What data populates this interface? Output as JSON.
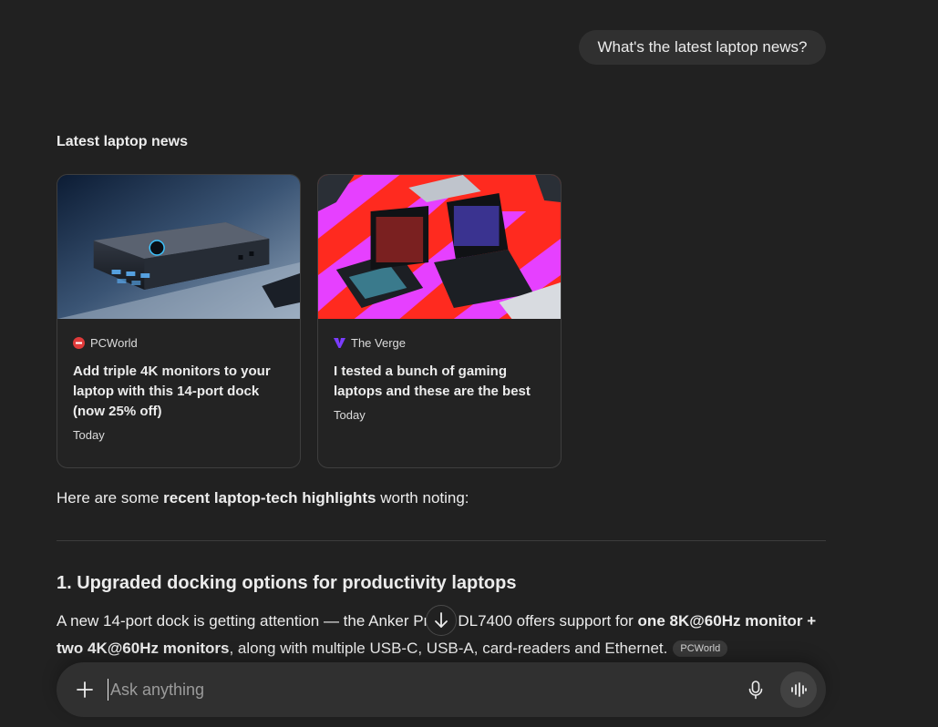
{
  "user_message": "What's the latest laptop news?",
  "news": {
    "section_title": "Latest laptop news",
    "cards": [
      {
        "source": "PCWorld",
        "headline": "Add triple 4K monitors to your laptop with this 14-port dock (now 25% off)",
        "date": "Today",
        "logo_color": "#e03a3a"
      },
      {
        "source": "The Verge",
        "headline": "I tested a bunch of gaming laptops and these are the best",
        "date": "Today",
        "logo_color": "#7b3cff"
      }
    ]
  },
  "answer": {
    "intro_before": "Here are some ",
    "intro_bold": "recent laptop-tech highlights",
    "intro_after": " worth noting:",
    "section_1": {
      "heading": "1. Upgraded docking options for productivity laptops",
      "text_1": "A new 14-port dock is getting attention — the Anker Prime DL7400 offers support for ",
      "bold_1": "one 8K@60Hz monitor + two 4K@60Hz monitors",
      "text_2": ", along with multiple USB-C, USB-A, card-readers and Ethernet.",
      "citation": "PCWorld"
    }
  },
  "composer": {
    "placeholder": "Ask anything"
  },
  "icons": {
    "add": "plus-icon",
    "mic": "microphone-icon",
    "voice": "voice-mode-icon",
    "scroll": "arrow-down-icon"
  }
}
